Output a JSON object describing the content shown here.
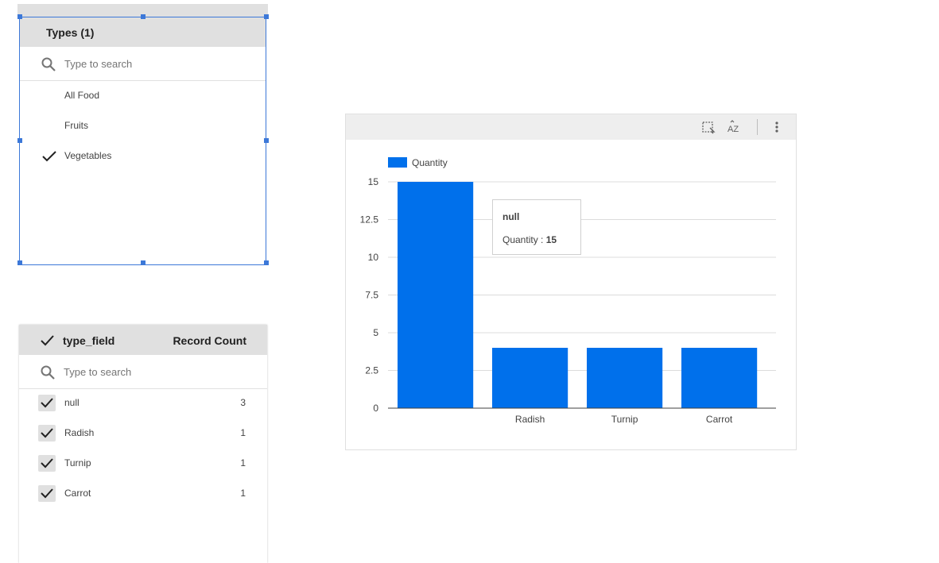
{
  "filter_types": {
    "title": "Types (1)",
    "search_placeholder": "Type to search",
    "options": [
      {
        "label": "All Food",
        "checked": false
      },
      {
        "label": "Fruits",
        "checked": false
      },
      {
        "label": "Vegetables",
        "checked": true
      }
    ]
  },
  "filter_type_field": {
    "column_dimension": "type_field",
    "column_metric": "Record Count",
    "search_placeholder": "Type to search",
    "rows": [
      {
        "label": "null",
        "count": "3",
        "checked": true
      },
      {
        "label": "Radish",
        "count": "1",
        "checked": true
      },
      {
        "label": "Turnip",
        "count": "1",
        "checked": true
      },
      {
        "label": "Carrot",
        "count": "1",
        "checked": true
      }
    ]
  },
  "chart_toolbar": {
    "icons": [
      "select-area-icon",
      "sort-az-icon",
      "more-vert-icon"
    ]
  },
  "chart_data": {
    "type": "bar",
    "categories": [
      "",
      "Radish",
      "Turnip",
      "Carrot"
    ],
    "series": [
      {
        "name": "Quantity",
        "values": [
          15,
          4,
          4,
          4
        ],
        "color": "#0070eb"
      }
    ],
    "ylim": [
      0,
      15
    ],
    "yticks": [
      "0",
      "2.5",
      "5",
      "7.5",
      "10",
      "12.5",
      "15"
    ],
    "ytick_values": [
      0,
      2.5,
      5,
      7.5,
      10,
      12.5,
      15
    ],
    "grid": true,
    "legend_position": "top-left"
  },
  "tooltip": {
    "title": "null",
    "label": "Quantity : ",
    "value": "15"
  },
  "colors": {
    "accent": "#3c78d8",
    "bar": "#0070eb",
    "header_bg": "#e0e0e0"
  }
}
